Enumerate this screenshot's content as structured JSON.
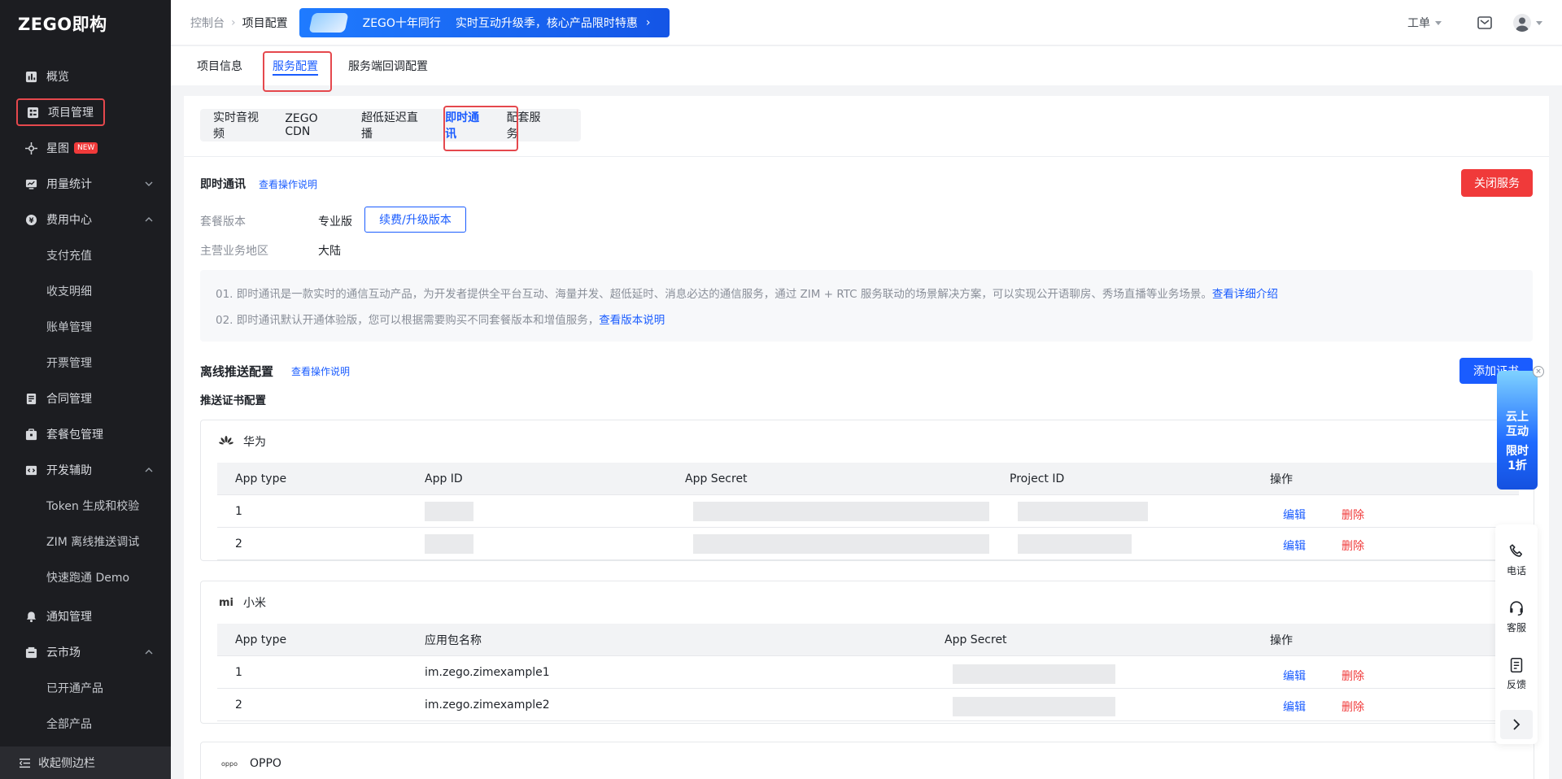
{
  "app": {
    "logo": "ZEGO即构"
  },
  "sidebar": {
    "items": [
      {
        "label": "概览"
      },
      {
        "label": "项目管理"
      },
      {
        "label": "星图",
        "badge": "NEW"
      },
      {
        "label": "用量统计"
      },
      {
        "label": "费用中心"
      },
      {
        "label": "支付充值"
      },
      {
        "label": "收支明细"
      },
      {
        "label": "账单管理"
      },
      {
        "label": "开票管理"
      },
      {
        "label": "合同管理"
      },
      {
        "label": "套餐包管理"
      },
      {
        "label": "开发辅助"
      },
      {
        "label": "Token 生成和校验"
      },
      {
        "label": "ZIM 离线推送调试"
      },
      {
        "label": "快速跑通 Demo"
      },
      {
        "label": "通知管理"
      },
      {
        "label": "云市场"
      },
      {
        "label": "已开通产品"
      },
      {
        "label": "全部产品"
      }
    ],
    "collapse_label": "收起侧边栏"
  },
  "header": {
    "breadcrumb": [
      "控制台",
      "项目配置"
    ],
    "banner": {
      "title": "ZEGO十年同行",
      "text": "实时互动升级季，核心产品限时特惠"
    },
    "ticket_label": "工单"
  },
  "page_tabs": [
    "项目信息",
    "服务配置",
    "服务端回调配置"
  ],
  "sub_tabs": [
    "实时音视频",
    "ZEGO CDN",
    "超低延迟直播",
    "即时通讯",
    "配套服务"
  ],
  "im": {
    "title": "即时通讯",
    "guide_link": "查看操作说明",
    "close_btn": "关闭服务",
    "plan_label": "套餐版本",
    "plan_value": "专业版",
    "upgrade_btn": "续费/升级版本",
    "region_label": "主营业务地区",
    "region_value": "大陆",
    "note1": "01. 即时通讯是一款实时的通信互动产品，为开发者提供全平台互动、海量并发、超低延时、消息必达的通信服务，通过 ZIM + RTC 服务联动的场景解决方案，可以实现公开语聊房、秀场直播等业务场景。",
    "note1_link": "查看详细介绍",
    "note2": "02. 即时通讯默认开通体验版，您可以根据需要购买不同套餐版本和增值服务，",
    "note2_link": "查看版本说明"
  },
  "push": {
    "title": "离线推送配置",
    "guide_link": "查看操作说明",
    "add_btn": "添加证书",
    "cert_title": "推送证书配置",
    "vendors": [
      {
        "name": "华为",
        "columns": [
          "App type",
          "App ID",
          "App Secret",
          "Project ID",
          "操作"
        ],
        "rows": [
          {
            "type": "1",
            "edit": "编辑",
            "delete": "删除"
          },
          {
            "type": "2",
            "edit": "编辑",
            "delete": "删除"
          }
        ]
      },
      {
        "name": "小米",
        "columns": [
          "App type",
          "应用包名称",
          "App Secret",
          "操作"
        ],
        "rows": [
          {
            "type": "1",
            "package": "im.zego.zimexample1",
            "edit": "编辑",
            "delete": "删除"
          },
          {
            "type": "2",
            "package": "im.zego.zimexample2",
            "edit": "编辑",
            "delete": "删除"
          }
        ]
      },
      {
        "name": "OPPO"
      }
    ]
  },
  "float": {
    "promo": [
      "云上",
      "互动",
      "限时",
      "1折"
    ],
    "tools": [
      "电话",
      "客服",
      "反馈"
    ]
  },
  "colors": {
    "brand_blue": "#1a5cff",
    "danger_red": "#f03a3a",
    "sidebar_bg": "#1c1d21"
  }
}
